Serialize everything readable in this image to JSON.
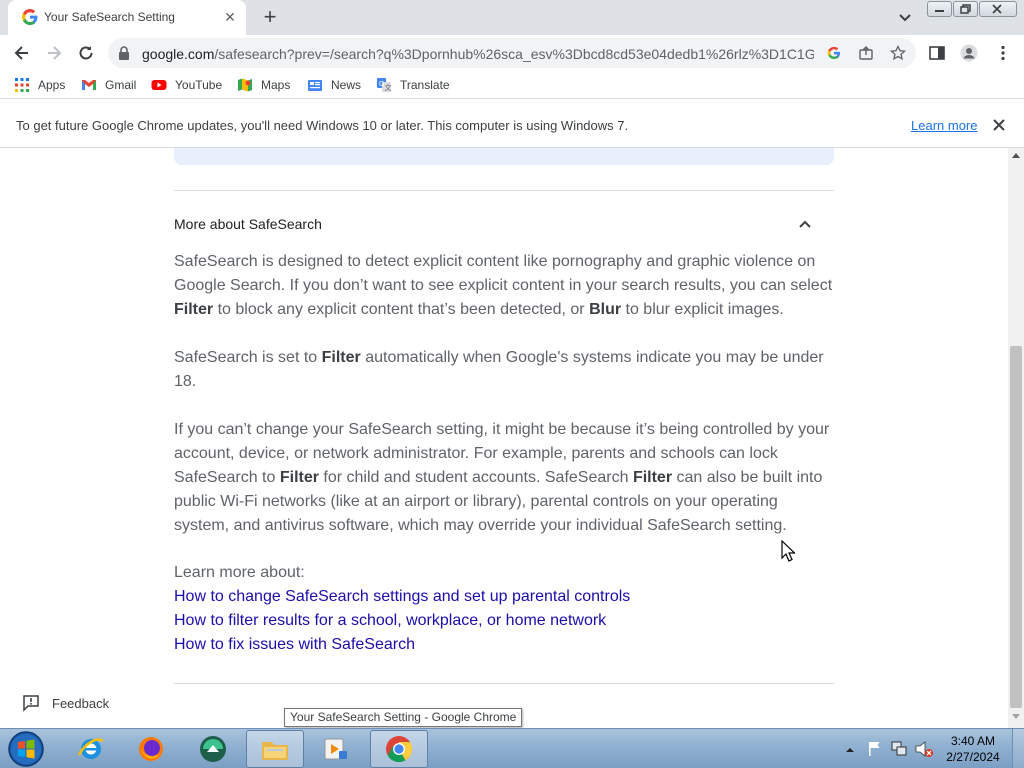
{
  "browser": {
    "tab": {
      "title": "Your SafeSearch Setting",
      "favicon": "google-g-icon"
    },
    "new_tab": "+",
    "url": {
      "domain": "google.com",
      "path": "/safesearch?prev=/search?q%3Dpornhub%26sca_esv%3Dbcd8cd53e04dedb1%26rlz%3D1C1G..."
    },
    "bookmarks": [
      {
        "label": "Apps",
        "icon": "apps-grid-icon"
      },
      {
        "label": "Gmail",
        "icon": "gmail-icon"
      },
      {
        "label": "YouTube",
        "icon": "youtube-icon"
      },
      {
        "label": "Maps",
        "icon": "maps-icon"
      },
      {
        "label": "News",
        "icon": "news-icon"
      },
      {
        "label": "Translate",
        "icon": "translate-icon"
      }
    ],
    "infobar": {
      "message": "To get future Google Chrome updates, you'll need Windows 10 or later. This computer is using Windows 7.",
      "link": "Learn more"
    }
  },
  "page": {
    "section_title": "More about SafeSearch",
    "para1": {
      "a": "SafeSearch is designed to detect explicit content like pornography and graphic violence on Google Search. If you don’t want to see explicit content in your search results, you can select ",
      "b1": "Filter",
      "c": " to block any explicit content that’s been detected, or ",
      "b2": "Blur",
      "d": " to blur explicit images."
    },
    "para2": {
      "a": "SafeSearch is set to ",
      "b1": "Filter",
      "c": " automatically when Google's systems indicate you may be under 18."
    },
    "para3": {
      "a": "If you can’t change your SafeSearch setting, it might be because it’s being controlled by your account, device, or network administrator. For example, parents and schools can lock SafeSearch to ",
      "b1": "Filter",
      "c": " for child and student accounts. SafeSearch ",
      "b2": "Filter",
      "d": " can also be built into public Wi-Fi networks (like at an airport or library), parental controls on your operating system, and antivirus software, which may override your individual SafeSearch setting."
    },
    "learn_more_label": "Learn more about:",
    "links": [
      "How to change SafeSearch settings and set up parental controls",
      "How to filter results for a school, workplace, or home network",
      "How to fix issues with SafeSearch"
    ],
    "feedback": "Feedback"
  },
  "tooltip": "Your SafeSearch Setting - Google Chrome",
  "taskbar": {
    "apps": [
      "internet-explorer-icon",
      "firefox-icon",
      "media-app-icon",
      "file-explorer-icon",
      "media-player-icon",
      "chrome-icon"
    ],
    "time": "3:40 AM",
    "date": "2/27/2024"
  },
  "colors": {
    "link": "#1a0dab",
    "accent": "#1a73e8",
    "highlight_box": "#e8f0fe"
  }
}
